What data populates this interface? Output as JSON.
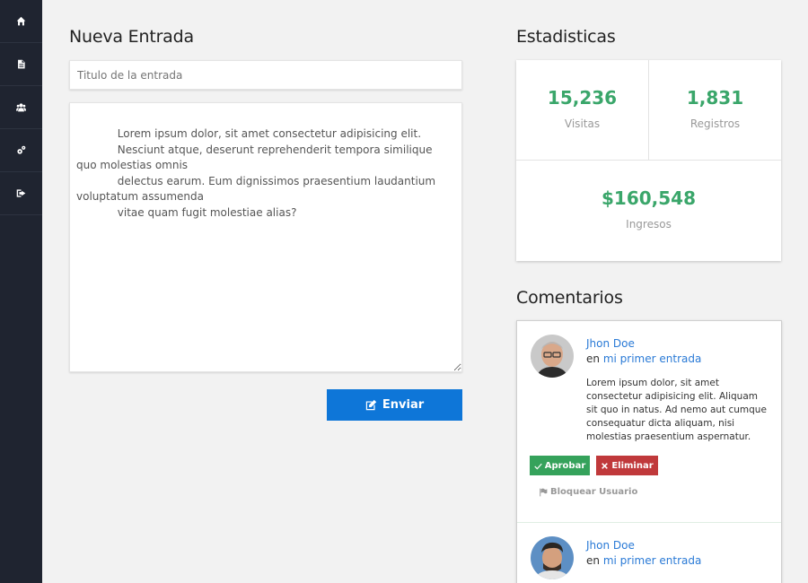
{
  "sidebar": {
    "items": [
      {
        "icon": "home-icon"
      },
      {
        "icon": "document-icon"
      },
      {
        "icon": "users-icon"
      },
      {
        "icon": "cogs-icon"
      },
      {
        "icon": "sign-out-icon"
      }
    ]
  },
  "new_entry": {
    "title": "Nueva Entrada",
    "title_placeholder": "Titulo de la entrada",
    "body_text": "            Lorem ipsum dolor, sit amet consectetur adipisicing elit.\n            Nesciunt atque, deserunt reprehenderit tempora similique quo molestias omnis\n            delectus earum. Eum dignissimos praesentium laudantium voluptatum assumenda\n            vitae quam fugit molestiae alias?",
    "send_label": "Enviar"
  },
  "stats": {
    "title": "Estadisticas",
    "visits_value": "15,236",
    "visits_label": "Visitas",
    "registrations_value": "1,831",
    "registrations_label": "Registros",
    "income_value": "$160,548",
    "income_label": "Ingresos"
  },
  "comments": {
    "title": "Comentarios",
    "items": [
      {
        "author": "Jhon Doe",
        "on": "en",
        "post": "mi primer entrada",
        "text": "Lorem ipsum dolor, sit amet consectetur adipisicing elit. Aliquam sit quo in natus. Ad nemo aut cumque consequatur dicta aliquam, nisi molestias praesentium aspernatur.",
        "approve_label": "Aprobar",
        "delete_label": "Eliminar",
        "block_label": "Bloquear Usuario"
      },
      {
        "author": "Jhon Doe",
        "on": "en",
        "post": "mi primer entrada"
      }
    ]
  },
  "colors": {
    "sidebar": "#1f2430",
    "accent": "#0e76d8",
    "stat_green": "#3aa66a",
    "approve": "#35a25b",
    "delete": "#c0393b"
  }
}
